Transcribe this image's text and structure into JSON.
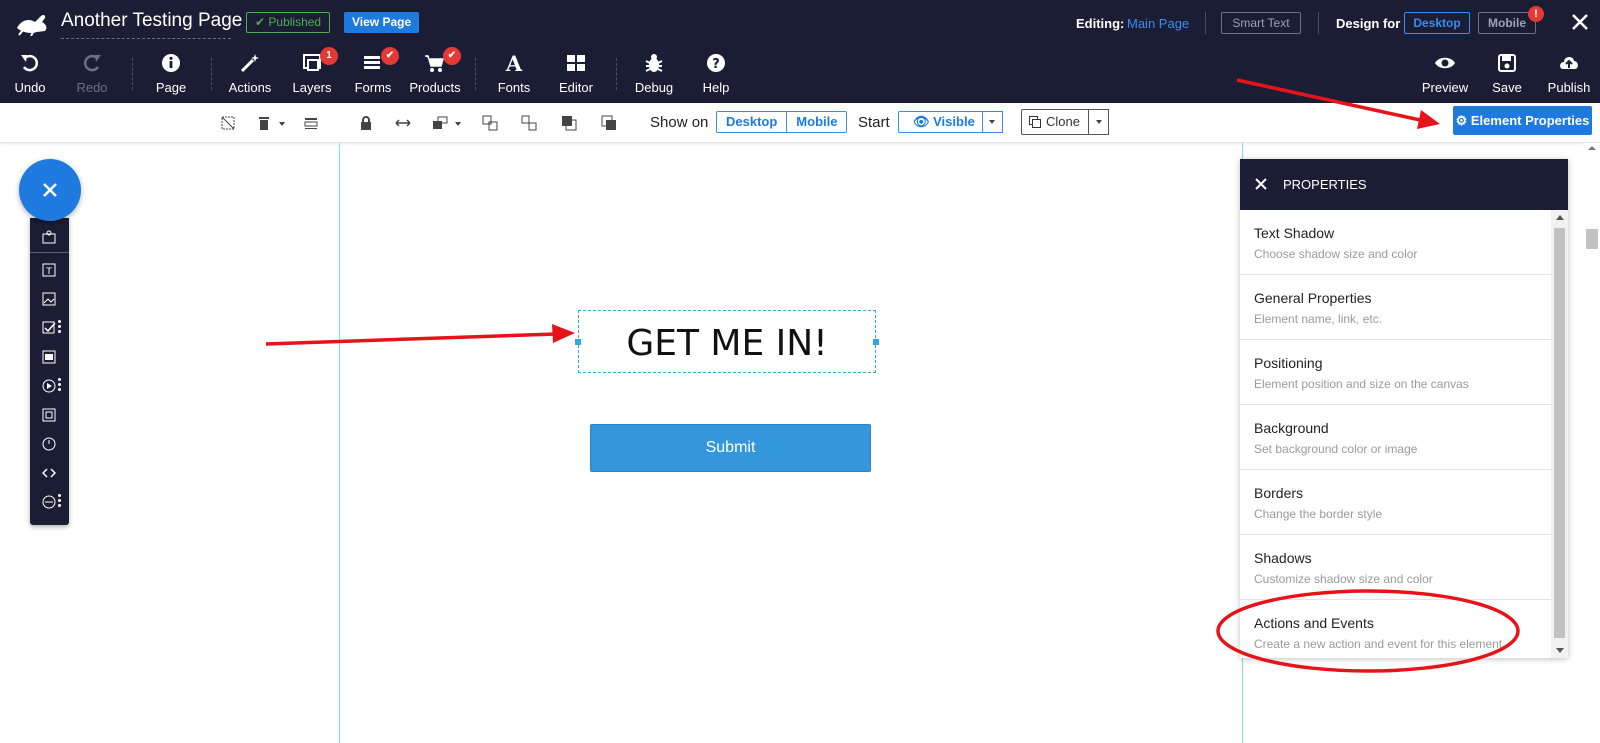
{
  "header": {
    "page_title": "Another Testing Page",
    "published_badge": "✔ Published",
    "view_page": "View Page",
    "editing_label": "Editing:",
    "editing_value": "Main Page",
    "smart_text": "Smart Text",
    "design_for_label": "Design for",
    "design_desktop": "Desktop",
    "design_mobile": "Mobile",
    "mobile_alert": "!"
  },
  "toolbar": {
    "undo": "Undo",
    "redo": "Redo",
    "page": "Page",
    "actions": "Actions",
    "layers": "Layers",
    "layers_count": "1",
    "forms": "Forms",
    "products": "Products",
    "fonts": "Fonts",
    "editor": "Editor",
    "debug": "Debug",
    "help": "Help",
    "preview": "Preview",
    "save": "Save",
    "publish": "Publish"
  },
  "subtoolbar": {
    "show_on_label": "Show on",
    "show_desktop": "Desktop",
    "show_mobile": "Mobile",
    "start_label": "Start",
    "visible": "Visible",
    "clone": "Clone",
    "element_properties": "Element Properties"
  },
  "canvas": {
    "headline": "GET ME IN!",
    "submit": "Submit"
  },
  "properties": {
    "title": "PROPERTIES",
    "items": [
      {
        "title": "Text Shadow",
        "desc": "Choose shadow size and color"
      },
      {
        "title": "General Properties",
        "desc": "Element name, link, etc."
      },
      {
        "title": "Positioning",
        "desc": "Element position and size on the canvas"
      },
      {
        "title": "Background",
        "desc": "Set background color or image"
      },
      {
        "title": "Borders",
        "desc": "Change the border style"
      },
      {
        "title": "Shadows",
        "desc": "Customize shadow size and color"
      },
      {
        "title": "Actions and Events",
        "desc": "Create a new action and event for this element"
      }
    ]
  },
  "colors": {
    "header_bg": "#1b1d35",
    "accent": "#1f7ae0",
    "submit_bg": "#3497db",
    "annotation": "#e8131a"
  }
}
